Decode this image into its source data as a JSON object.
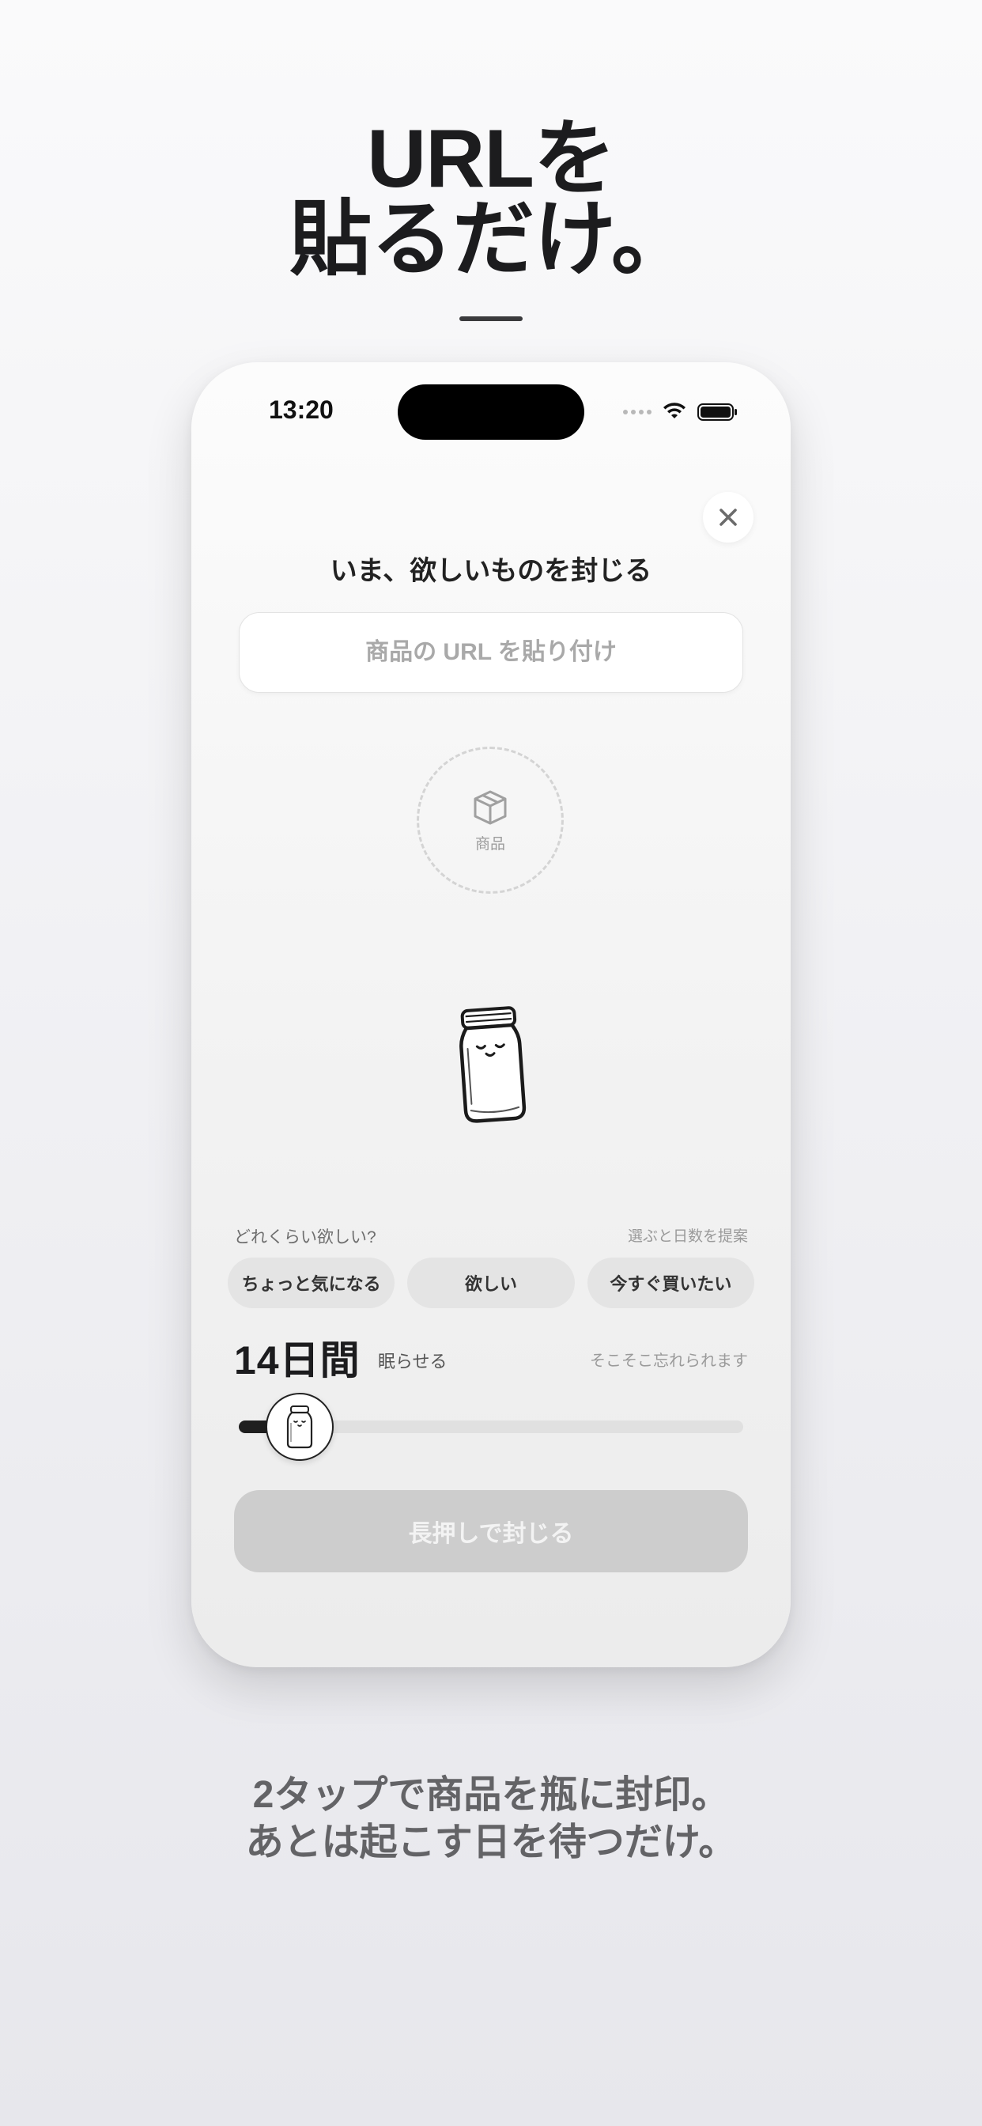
{
  "headline": {
    "line1": "URLを",
    "line2": "貼るだけ。"
  },
  "status_bar": {
    "time": "13:20",
    "icons": [
      "signal-dots-icon",
      "wifi-icon",
      "battery-icon"
    ]
  },
  "sheet": {
    "title": "いま、欲しいものを封じる",
    "close_icon": "close-icon",
    "url_field": {
      "placeholder": "商品の URL を貼り付け",
      "value": ""
    },
    "product_slot": {
      "icon": "box-icon",
      "label": "商品"
    },
    "jar_icon": "sleeping-jar-icon",
    "want_question": "どれくらい欲しい?",
    "want_hint": "選ぶと日数を提案",
    "want_options": [
      "ちょっと気になる",
      "欲しい",
      "今すぐ買いたい"
    ],
    "duration": {
      "value": "14日間",
      "suffix": "眠らせる",
      "note": "そこそこ忘れられます"
    },
    "slider": {
      "fraction": 0.12,
      "thumb_icon": "jar-icon"
    },
    "seal_button": "長押しで封じる"
  },
  "caption": {
    "line1": "2タップで商品を瓶に封印。",
    "line2": "あとは起こす日を待つだけ。"
  },
  "colors": {
    "accent": "#1f1f1f",
    "chip": "#e4e4e4",
    "disabled_button": "#cdcdcd",
    "caption": "#636366"
  }
}
